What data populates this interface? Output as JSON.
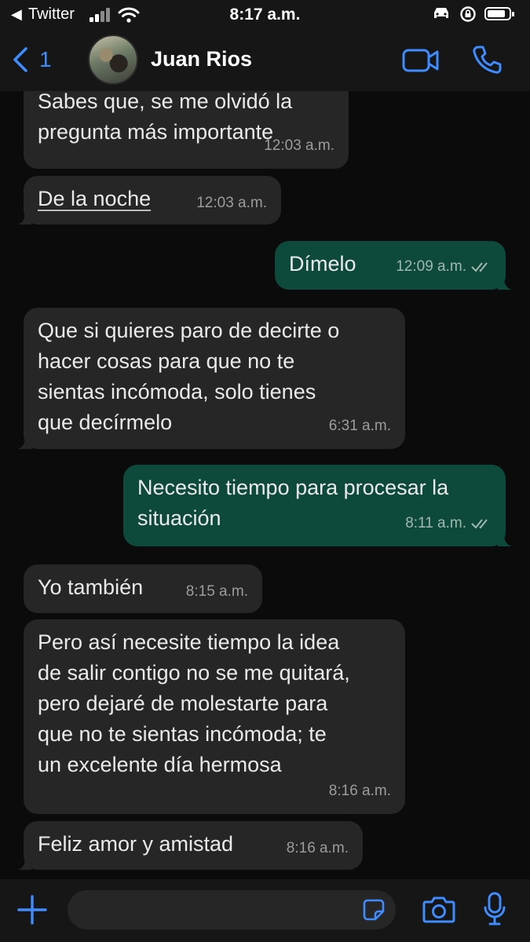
{
  "status_bar": {
    "back_glyph": "◀",
    "carrier": "Twitter",
    "time": "8:17 a.m.",
    "battery_level_fraction": 0.85
  },
  "header": {
    "back_count": "1",
    "contact_name": "Juan Rios"
  },
  "messages": [
    {
      "direction": "incoming",
      "text": "Sabes que, se me olvidó la\npregunta más importante",
      "time": "12:03 a.m."
    },
    {
      "direction": "incoming",
      "text": "De la noche",
      "time": "12:03 a.m."
    },
    {
      "direction": "outgoing",
      "text": "Dímelo",
      "time": "12:09 a.m.",
      "status": "read"
    },
    {
      "direction": "incoming",
      "text": "Que si quieres paro de decirte o\nhacer cosas para que no te\nsientas incómoda, solo tienes\nque decírmelo",
      "time": "6:31 a.m."
    },
    {
      "direction": "outgoing",
      "text": "Necesito tiempo para procesar la\nsituación",
      "time": "8:11 a.m.",
      "status": "read"
    },
    {
      "direction": "incoming",
      "text": "Yo también",
      "time": "8:15 a.m."
    },
    {
      "direction": "incoming",
      "text": "Pero así necesite tiempo la idea\nde salir contigo no se me quitará,\npero dejaré de molestarte para\nque no te sientas incómoda; te\nun excelente día hermosa",
      "time": "8:16 a.m."
    },
    {
      "direction": "incoming",
      "text": "Feliz amor y amistad",
      "time": "8:16 a.m."
    }
  ],
  "composer": {
    "placeholder": ""
  },
  "icons": {
    "back": "chevron-left-icon",
    "video": "video-camera-icon",
    "phone": "phone-icon",
    "plus": "plus-icon",
    "sticker": "sticker-icon",
    "camera": "camera-icon",
    "mic": "microphone-icon"
  },
  "colors": {
    "accent": "#3f8cff",
    "incoming_bubble": "#262626",
    "outgoing_bubble": "#0e4a3c",
    "background": "#0b0b0b"
  }
}
